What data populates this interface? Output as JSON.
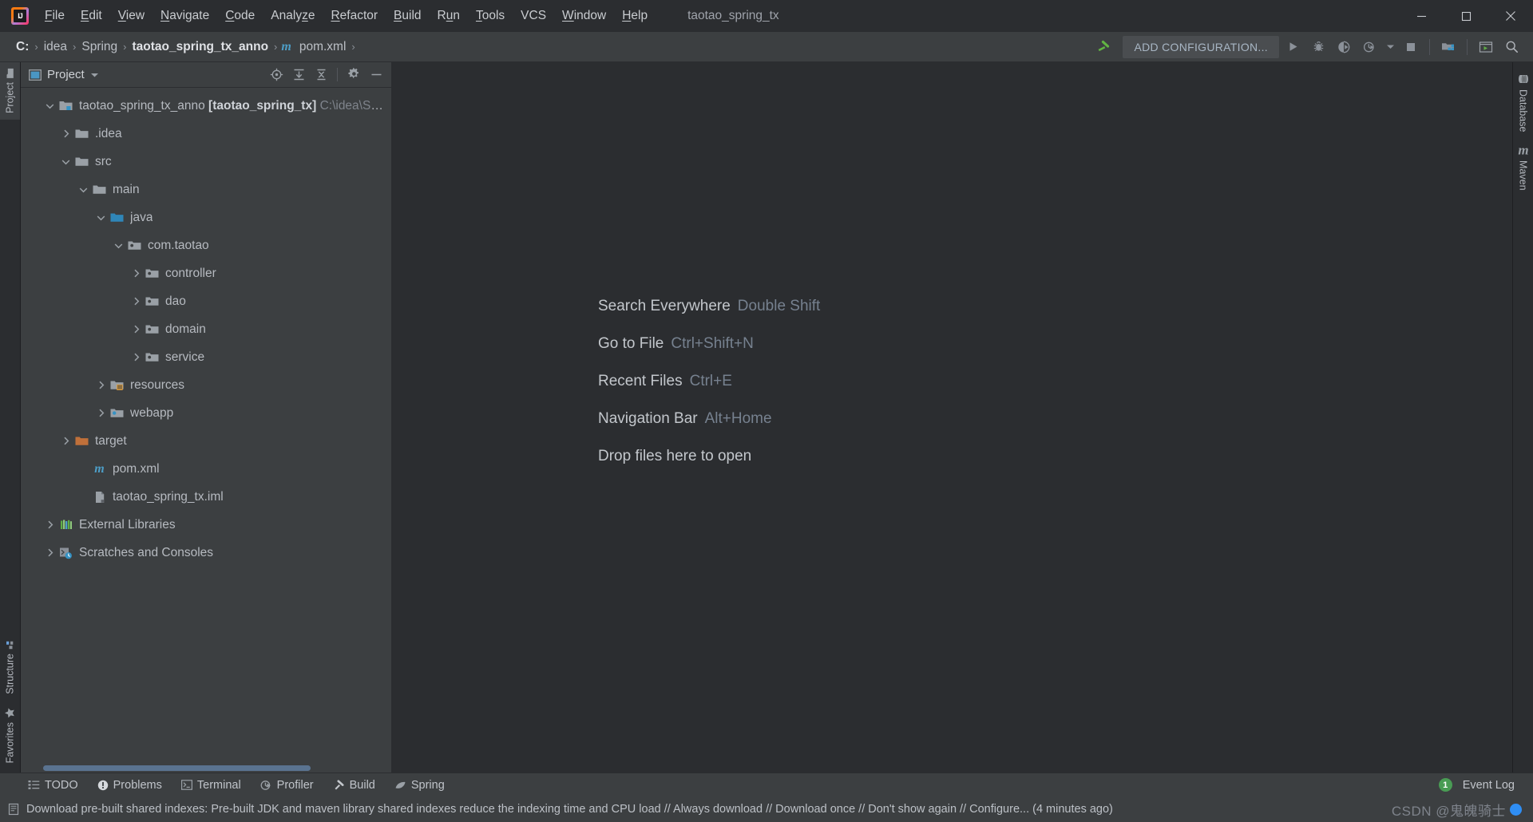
{
  "window": {
    "title": "taotao_spring_tx",
    "controls": [
      "minimize",
      "maximize",
      "close"
    ]
  },
  "menubar": {
    "logo_icon": "intellij-idea-logo",
    "items": [
      {
        "label": "File",
        "mnemonic": "F"
      },
      {
        "label": "Edit",
        "mnemonic": "E"
      },
      {
        "label": "View",
        "mnemonic": "V"
      },
      {
        "label": "Navigate",
        "mnemonic": "N"
      },
      {
        "label": "Code",
        "mnemonic": "C"
      },
      {
        "label": "Analyze",
        "mnemonic": "z"
      },
      {
        "label": "Refactor",
        "mnemonic": "R"
      },
      {
        "label": "Build",
        "mnemonic": "B"
      },
      {
        "label": "Run",
        "mnemonic": "u"
      },
      {
        "label": "Tools",
        "mnemonic": "T"
      },
      {
        "label": "VCS",
        "mnemonic": ""
      },
      {
        "label": "Window",
        "mnemonic": "W"
      },
      {
        "label": "Help",
        "mnemonic": "H"
      }
    ]
  },
  "navbar": {
    "breadcrumbs": [
      {
        "label": "C:",
        "bold": true,
        "icon": null
      },
      {
        "label": "idea",
        "bold": false,
        "icon": null
      },
      {
        "label": "Spring",
        "bold": false,
        "icon": null
      },
      {
        "label": "taotao_spring_tx_anno",
        "bold": true,
        "icon": null
      },
      {
        "label": "pom.xml",
        "bold": false,
        "icon": "maven-m-icon"
      }
    ],
    "separator": "›",
    "hammer_icon": "build-hammer-icon",
    "add_configuration_label": "ADD CONFIGURATION...",
    "buttons": [
      {
        "name": "run-button",
        "icon": "run-triangle-icon"
      },
      {
        "name": "debug-button",
        "icon": "debug-bug-icon"
      },
      {
        "name": "run-with-coverage-button",
        "icon": "coverage-icon"
      },
      {
        "name": "profiler-button",
        "icon": "profiler-clock-icon"
      },
      {
        "name": "profiler-dropdown",
        "icon": "chevron-down-icon"
      },
      {
        "name": "stop-button",
        "icon": "stop-square-icon"
      },
      {
        "name": "project-structure-button",
        "icon": "project-structure-icon"
      },
      {
        "name": "updates-button",
        "icon": "window-terminal-icon"
      },
      {
        "name": "search-everywhere-button",
        "icon": "search-icon"
      }
    ]
  },
  "left_rail": {
    "top": [
      {
        "label": "Project",
        "icon": "project-folder-icon",
        "active": true
      }
    ],
    "bottom": [
      {
        "label": "Structure",
        "icon": "structure-icon",
        "active": false
      },
      {
        "label": "Favorites",
        "icon": "star-icon",
        "active": false
      }
    ]
  },
  "right_rail": {
    "items": [
      {
        "label": "Database",
        "icon": "database-icon"
      },
      {
        "label": "Maven",
        "icon": "maven-m-icon"
      }
    ]
  },
  "project_panel": {
    "title": "Project",
    "title_icon": "project-window-icon",
    "dropdown_icon": "chevron-down-icon",
    "header_buttons": [
      {
        "name": "select-opened-file-button",
        "icon": "crosshair-target-icon"
      },
      {
        "name": "expand-all-button",
        "icon": "expand-all-icon"
      },
      {
        "name": "collapse-all-button",
        "icon": "collapse-all-icon"
      },
      {
        "name": "settings-button",
        "icon": "gear-icon"
      },
      {
        "name": "hide-button",
        "icon": "minimize-dash-icon"
      }
    ],
    "tree": [
      {
        "depth": 0,
        "arrow": "down",
        "icon": "module-folder-icon",
        "label": "taotao_spring_tx_anno",
        "bracket": "[taotao_spring_tx]",
        "path": "C:\\idea\\Spring"
      },
      {
        "depth": 1,
        "arrow": "right",
        "icon": "folder-icon",
        "label": ".idea"
      },
      {
        "depth": 1,
        "arrow": "down",
        "icon": "folder-icon",
        "label": "src"
      },
      {
        "depth": 2,
        "arrow": "down",
        "icon": "folder-icon",
        "label": "main"
      },
      {
        "depth": 3,
        "arrow": "down",
        "icon": "source-root-folder-icon",
        "label": "java"
      },
      {
        "depth": 4,
        "arrow": "down",
        "icon": "package-icon",
        "label": "com.taotao"
      },
      {
        "depth": 5,
        "arrow": "right",
        "icon": "package-icon",
        "label": "controller"
      },
      {
        "depth": 5,
        "arrow": "right",
        "icon": "package-icon",
        "label": "dao"
      },
      {
        "depth": 5,
        "arrow": "right",
        "icon": "package-icon",
        "label": "domain"
      },
      {
        "depth": 5,
        "arrow": "right",
        "icon": "package-icon",
        "label": "service"
      },
      {
        "depth": 3,
        "arrow": "right",
        "icon": "resources-root-folder-icon",
        "label": "resources"
      },
      {
        "depth": 3,
        "arrow": "right",
        "icon": "webapp-folder-icon",
        "label": "webapp"
      },
      {
        "depth": 1,
        "arrow": "right",
        "icon": "excluded-folder-icon",
        "label": "target"
      },
      {
        "depth": 2,
        "arrow": "none",
        "icon": "maven-m-icon",
        "label": "pom.xml"
      },
      {
        "depth": 2,
        "arrow": "none",
        "icon": "iml-file-icon",
        "label": "taotao_spring_tx.iml"
      },
      {
        "depth": 0,
        "arrow": "right",
        "icon": "external-libraries-icon",
        "label": "External Libraries"
      },
      {
        "depth": 0,
        "arrow": "right",
        "icon": "scratches-icon",
        "label": "Scratches and Consoles"
      }
    ]
  },
  "editor": {
    "hints": [
      {
        "action": "Search Everywhere",
        "shortcut": "Double Shift"
      },
      {
        "action": "Go to File",
        "shortcut": "Ctrl+Shift+N"
      },
      {
        "action": "Recent Files",
        "shortcut": "Ctrl+E"
      },
      {
        "action": "Navigation Bar",
        "shortcut": "Alt+Home"
      },
      {
        "action": "Drop files here to open",
        "shortcut": ""
      }
    ]
  },
  "bottom_toolwindows": {
    "items": [
      {
        "label": "TODO",
        "icon": "todo-list-icon"
      },
      {
        "label": "Problems",
        "icon": "problems-warning-icon"
      },
      {
        "label": "Terminal",
        "icon": "terminal-icon"
      },
      {
        "label": "Profiler",
        "icon": "profiler-clock-icon"
      },
      {
        "label": "Build",
        "icon": "build-hammer-icon"
      },
      {
        "label": "Spring",
        "icon": "spring-leaf-icon"
      }
    ],
    "event_log": {
      "label": "Event Log",
      "badge_count": "1",
      "badge_color": "#499c54"
    }
  },
  "statusbar": {
    "icon": "notification-document-icon",
    "message": "Download pre-built shared indexes: Pre-built JDK and maven library shared indexes reduce the indexing time and CPU load // Always download // Download once // Don't show again // Configure... (4 minutes ago)",
    "watermark": "CSDN @鬼魄骑士"
  },
  "colors": {
    "window_bg": "#2b2d30",
    "panel_bg": "#3c3f41",
    "text": "#bcc0c6",
    "dim_text": "#7f848c",
    "accent_blue": "#4d9ec7",
    "green": "#499c54",
    "orange": "#c0703a",
    "scrollbar": "#5a7390"
  }
}
